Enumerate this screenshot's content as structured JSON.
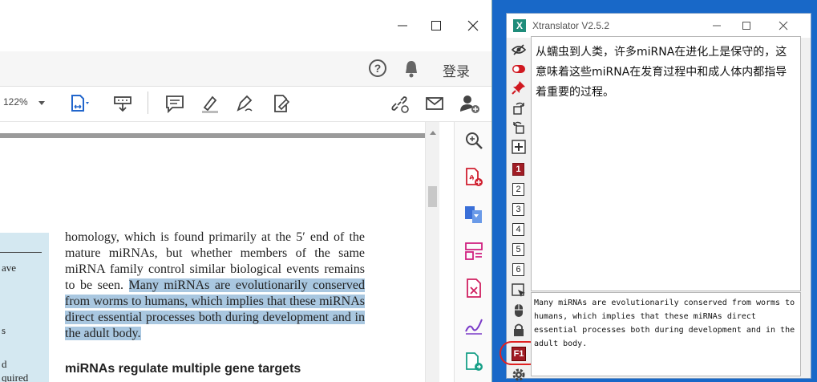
{
  "pdf": {
    "menu": {
      "login_label": "登录",
      "help_glyph": "?"
    },
    "toolbar": {
      "zoom_value": "122%"
    },
    "doc": {
      "sidebar_fragments": [
        "ave",
        "s",
        "d",
        "quired"
      ],
      "para_plain": "homology, which is found primarily at the 5′ end of the mature miRNAs, but whether members of the same miRNA family control similar biological events remains to be seen. ",
      "para_highlighted": "Many miRNAs are evolutionarily conserved from worms to humans, which implies that these miRNAs direct essential processes both during development and in the adult body.",
      "section_heading": "miRNAs regulate multiple gene targets"
    }
  },
  "xtranslator": {
    "title": "Xtranslator V2.5.2",
    "logo": "X",
    "engine_numbers": [
      "1",
      "2",
      "3",
      "4",
      "5",
      "6"
    ],
    "active_engine": "1",
    "f1_label": "F1",
    "translation": "从蠕虫到人类，许多miRNA在进化上是保守的，这意味着这些miRNA在发育过程中和成人体内都指导着重要的过程。",
    "source_text": "Many miRNAs are evolutionarily conserved from worms to humans, which implies that these miRNAs direct essential processes both during development and in the adult body."
  },
  "colors": {
    "highlight": "#a9c7e0",
    "accent_red": "#a01c24",
    "desktop": "#1868c8"
  }
}
